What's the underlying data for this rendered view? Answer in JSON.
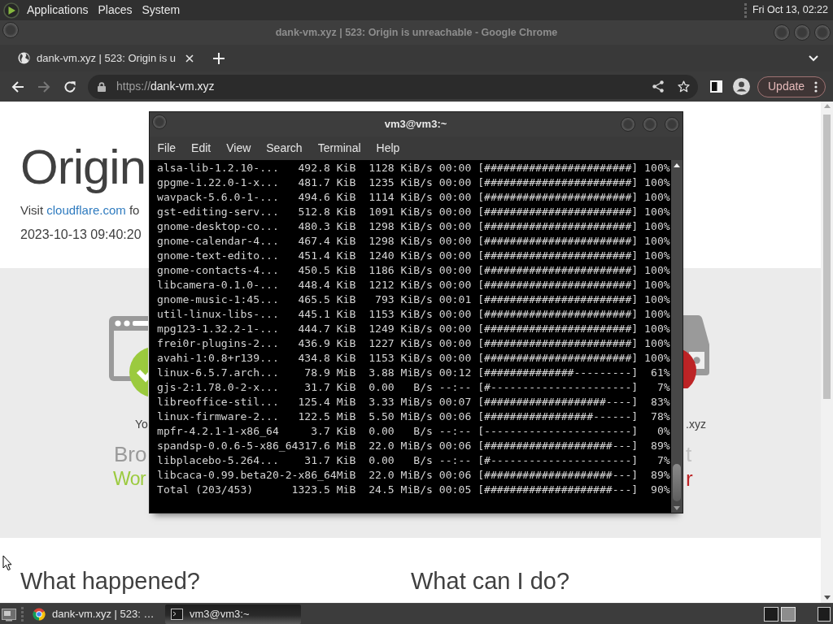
{
  "top_panel": {
    "menus": [
      "Applications",
      "Places",
      "System"
    ],
    "clock": "Fri Oct 13, 02:22"
  },
  "browser": {
    "window_title": "dank-vm.xyz | 523: Origin is unreachable - Google Chrome",
    "tabs": [
      {
        "title": "dank-vm.xyz | 523: Origin is u"
      }
    ],
    "nav_buttons": [
      {
        "kind": "back",
        "disabled": false
      },
      {
        "kind": "forward",
        "disabled": true
      },
      {
        "kind": "reload",
        "disabled": false
      }
    ],
    "url": {
      "scheme": "https://",
      "host": "dank-vm.xyz"
    },
    "update_button": "Update"
  },
  "page": {
    "heading": "Origin",
    "visit_line": {
      "text": "Visit",
      "link": "cloudflare.com",
      "rest": "fo"
    },
    "timestamp": "2023-10-13 09:40:20",
    "status_columns": [
      {
        "kind": "browser",
        "label": "Yo",
        "title": "Bro",
        "status": "Wor",
        "color": "#9bca3e"
      },
      {
        "kind": "host",
        "label": ".xyz",
        "title": "t",
        "status": "r",
        "color": "#bd2426"
      }
    ],
    "sections": [
      "What happened?",
      "What can I do?"
    ]
  },
  "terminal": {
    "title": "vm3@vm3:~",
    "menus": [
      "File",
      "Edit",
      "View",
      "Search",
      "Terminal",
      "Help"
    ],
    "lines": [
      "alsa-lib-1.2.10-...   492.8 KiB  1128 KiB/s 00:00 [#######################] 100%",
      "gpgme-1.22.0-1-x...   481.7 KiB  1235 KiB/s 00:00 [#######################] 100%",
      "wavpack-5.6.0-1-...   494.6 KiB  1114 KiB/s 00:00 [#######################] 100%",
      "gst-editing-serv...   512.8 KiB  1091 KiB/s 00:00 [#######################] 100%",
      "gnome-desktop-co...   480.3 KiB  1298 KiB/s 00:00 [#######################] 100%",
      "gnome-calendar-4...   467.4 KiB  1298 KiB/s 00:00 [#######################] 100%",
      "gnome-text-edito...   451.4 KiB  1240 KiB/s 00:00 [#######################] 100%",
      "gnome-contacts-4...   450.5 KiB  1186 KiB/s 00:00 [#######################] 100%",
      "libcamera-0.1.0-...   448.4 KiB  1212 KiB/s 00:00 [#######################] 100%",
      "gnome-music-1:45...   465.5 KiB   793 KiB/s 00:01 [#######################] 100%",
      "util-linux-libs-...   445.1 KiB  1153 KiB/s 00:00 [#######################] 100%",
      "mpg123-1.32.2-1-...   444.7 KiB  1249 KiB/s 00:00 [#######################] 100%",
      "frei0r-plugins-2...   436.9 KiB  1227 KiB/s 00:00 [#######################] 100%",
      "avahi-1:0.8+r139...   434.8 KiB  1153 KiB/s 00:00 [#######################] 100%",
      "linux-6.5.7.arch...    78.9 MiB  3.88 MiB/s 00:12 [##############---------]  61%",
      "gjs-2:1.78.0-2-x...    31.7 KiB  0.00   B/s --:-- [#----------------------]   7%",
      "libreoffice-stil...   125.4 MiB  3.33 MiB/s 00:07 [###################----]  83%",
      "linux-firmware-2...   122.5 MiB  5.50 MiB/s 00:06 [#################------]  78%",
      "mpfr-4.2.1-1-x86_64     3.7 KiB  0.00   B/s --:-- [-----------------------]   0%",
      "spandsp-0.0.6-5-x86_64317.6 MiB  22.0 MiB/s 00:06 [####################---]  89%",
      "libplacebo-5.264...    31.7 KiB  0.00   B/s --:-- [#----------------------]   7%",
      "libcaca-0.99.beta20-2-x86_64MiB  22.0 MiB/s 00:06 [####################---]  89%",
      "Total (203/453)      1323.5 MiB  24.5 MiB/s 00:05 [####################---]  90%"
    ]
  },
  "taskbar": {
    "windows": [
      {
        "kind": "browser",
        "title": "dank-vm.xyz | 523: …",
        "selected": false
      },
      {
        "kind": "terminal",
        "title": "vm3@vm3:~",
        "selected": true
      }
    ],
    "workspaces": [
      {
        "selected": false
      },
      {
        "selected": true
      }
    ]
  }
}
